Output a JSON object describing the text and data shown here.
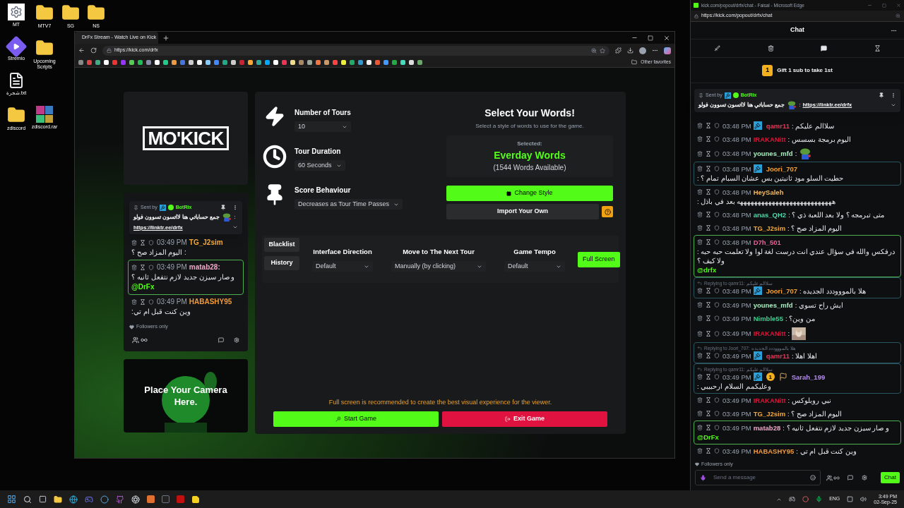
{
  "desktop_icons": [
    {
      "kind": "settings",
      "label": "MT"
    },
    {
      "kind": "folder",
      "label": "MTV7"
    },
    {
      "kind": "folder",
      "label": "SG"
    },
    {
      "kind": "folder",
      "label": "NS"
    },
    {
      "kind": "app",
      "label": "Stremio"
    },
    {
      "kind": "folder",
      "label": "Upcoming Scripts"
    },
    {
      "kind": "text",
      "label": "شجرة.txt"
    },
    {
      "kind": "folder",
      "label": "zdiscord"
    },
    {
      "kind": "archive",
      "label": "zdiscord.rar"
    }
  ],
  "browser": {
    "tab_title": "DrFx Stream - Watch Live on Kick",
    "url": "https://kick.com/drfx",
    "favorites_label": "Other favorites"
  },
  "game": {
    "logo": "MO'KICK",
    "settings": [
      {
        "kind": "bolt",
        "label": "Number of Tours",
        "value": "10"
      },
      {
        "kind": "clock",
        "label": "Tour Duration",
        "value": "60 Seconds"
      },
      {
        "kind": "pin",
        "label": "Score Behaviour",
        "value": "Decreases as Tour Time Passes"
      }
    ],
    "words": {
      "title": "Select Your Words!",
      "subtitle": "Select a style of words to use for the game.",
      "selected_label": "Selected:",
      "selected_name": "Everday Words",
      "count": "(1544 Words Available)",
      "change_button": "Change Style",
      "import_button": "Import Your Own"
    },
    "side_tabs": [
      {
        "label": "Blacklist"
      },
      {
        "label": "History"
      }
    ],
    "options": [
      {
        "label": "Interface Direction",
        "value": "Default"
      },
      {
        "label": "Move to The Next Tour",
        "value": "Manually (by clicking)"
      },
      {
        "label": "Game Tempo",
        "value": "Default"
      }
    ],
    "fullscreen_button": "Full Screen",
    "notice": "Full screen is recommended to create the best visual experience for the viewer.",
    "start_button": "Start Game",
    "exit_button": "Exit Game",
    "camera_text": "Place Your Camera Here."
  },
  "stream_chat": {
    "pinned": {
      "sent_by": "Sent by",
      "author": "BotRix",
      "text": "جمع حساباتي هنا لااتسون تسوون فولو",
      "separator": ":",
      "link": "https://linktr.ee/drfx"
    },
    "messages": [
      {
        "time": "03:49 PM",
        "user": "TG_J2sim",
        "color": "#f4a83a",
        "text": "اليوم المزاد صح ؟ :",
        "highlighted": false
      },
      {
        "time": "03:49 PM",
        "user": "matab28:",
        "color": "#f0a8c8",
        "text": "و صار سيزن جديد لازم نتفعل ثانيه ؟",
        "mention": "@DrFx",
        "highlighted": true
      },
      {
        "time": "03:49 PM",
        "user": "HABASHY95",
        "color": "#f29a3a",
        "text": ":وين كنت قبل ام تي",
        "highlighted": false
      }
    ],
    "followers_only": "Followers only"
  },
  "chat_window": {
    "title": "kick.com/popout/drfx/chat - Faisal - Microsoft Edge",
    "url": "https://kick.com/popout/drfx/chat",
    "header": "Chat",
    "gift": {
      "rank": "1",
      "text": "Gift 1 sub to take 1st"
    },
    "pinned": {
      "sent_by": "Sent by",
      "author": "BotRix",
      "text": "جمع حساباتي هنا لااتسون تسوون فولو",
      "separator": ":",
      "link": "https://linktr.ee/drfx"
    },
    "messages": [
      {
        "kind": "text",
        "time": "03:48 PM",
        "user": "qamr11",
        "color": "#e8365a",
        "badges": [
          {
            "kind": "mod"
          }
        ],
        "text": ": سلاالم عليكم",
        "highlighted": false
      },
      {
        "kind": "text",
        "time": "03:48 PM",
        "user": "IRAKANitt",
        "color": "#d3183c",
        "text": ": اليوم برمجة بسسس",
        "highlighted": false
      },
      {
        "kind": "emote",
        "time": "03:48 PM",
        "user": "younes_mfd",
        "color": "#a8ecc0",
        "text": ":",
        "highlighted": false
      },
      {
        "kind": "text",
        "time": "03:48 PM",
        "user": "Joori_707",
        "color": "#f5a23a",
        "badges": [
          {
            "kind": "mod"
          }
        ],
        "text": ": حطيت السلو مود ثانيتين بس عشان السبام تمام ؟",
        "highlighted": true
      },
      {
        "kind": "text",
        "time": "03:48 PM",
        "user": "HeySaleh",
        "color": "#f0b860",
        "text": ": هههههههههههههههههههههههههههه بعد في باذل",
        "highlighted": false
      },
      {
        "kind": "text",
        "time": "03:48 PM",
        "user": "anas_QH2",
        "color": "#52d6a8",
        "text": ": متى تبرمجه ؟ ولا بعد اللعبة ذي ؟",
        "highlighted": false
      },
      {
        "kind": "text",
        "time": "03:48 PM",
        "user": "TG_J2sim",
        "color": "#f4a83a",
        "text": ": اليوم المزاد صح ؟",
        "highlighted": false
      },
      {
        "kind": "text",
        "time": "03:48 PM",
        "user": "D7h_501",
        "color": "#e8609a",
        "text": ": درفكس والله في سؤال عندي انت درست لغة لوا ولا تعلمت حبه حبه ولا كيف ؟",
        "mention": "@drfx",
        "highlighted": true
      },
      {
        "kind": "text",
        "time": "03:48 PM",
        "user": "Joori_707",
        "color": "#f5a23a",
        "badges": [
          {
            "kind": "mod"
          }
        ],
        "text": ": هلا بالموووددد الجديده",
        "reply_to": "Replying to qamr11: سلاالم عليكم",
        "highlighted": true
      },
      {
        "kind": "text",
        "time": "03:49 PM",
        "user": "younes_mfd",
        "color": "#a8ecc0",
        "text": ": ايش راح تسوي",
        "highlighted": false
      },
      {
        "kind": "text",
        "time": "03:49 PM",
        "user": "Nimble55",
        "color": "#3ccf91",
        "text": ": من وين؟",
        "highlighted": false
      },
      {
        "time": "03:49 PM",
        "user": "IRAKANitt",
        "color": "#d3183c",
        "text": ":",
        "highlighted": false
      },
      {
        "kind": "text",
        "time": "03:49 PM",
        "user": "qamr11",
        "color": "#e8365a",
        "badges": [
          {
            "kind": "mod"
          }
        ],
        "text": ": اهلا اهلا",
        "reply_to": "Replying to Joori_707: هلا بالموووددد الجديده",
        "highlighted": true
      },
      {
        "kind": "text",
        "time": "03:49 PM",
        "user": "Sarah_199",
        "color": "#b48cf2",
        "badges": [
          {
            "kind": "mod"
          },
          {
            "kind": "sub",
            "label": "1"
          },
          {
            "kind": "gifter"
          }
        ],
        "text": ": وعليكمم السلام ارحبيبي",
        "reply_to": "Replying to qamr11: سلاالم عليكم",
        "highlighted": true
      },
      {
        "kind": "text",
        "time": "03:49 PM",
        "user": "IRAKANitt",
        "color": "#d3183c",
        "text": ": نبي روبلوكس",
        "highlighted": false
      },
      {
        "kind": "text",
        "time": "03:49 PM",
        "user": "TG_J2sim",
        "color": "#f4a83a",
        "text": ": اليوم المزاد صح ؟",
        "highlighted": false
      },
      {
        "kind": "text",
        "time": "03:49 PM",
        "user": "matab28",
        "color": "#f0a8c8",
        "text": ": و صار سيزن جديد لازم نتفعل ثانيه ؟",
        "mention": "@DrFx",
        "highlighted": true
      },
      {
        "kind": "text",
        "time": "03:49 PM",
        "user": "HABASHY95",
        "color": "#f29a3a",
        "text": ": وين كنت قبل ام تي",
        "highlighted": false
      }
    ],
    "followers_only": "Followers only",
    "input_placeholder": "Send a message",
    "send_button": "Chat"
  },
  "taskbar": {
    "language": "ENG",
    "time": "3:49 PM",
    "date": "02-Sep-25"
  }
}
